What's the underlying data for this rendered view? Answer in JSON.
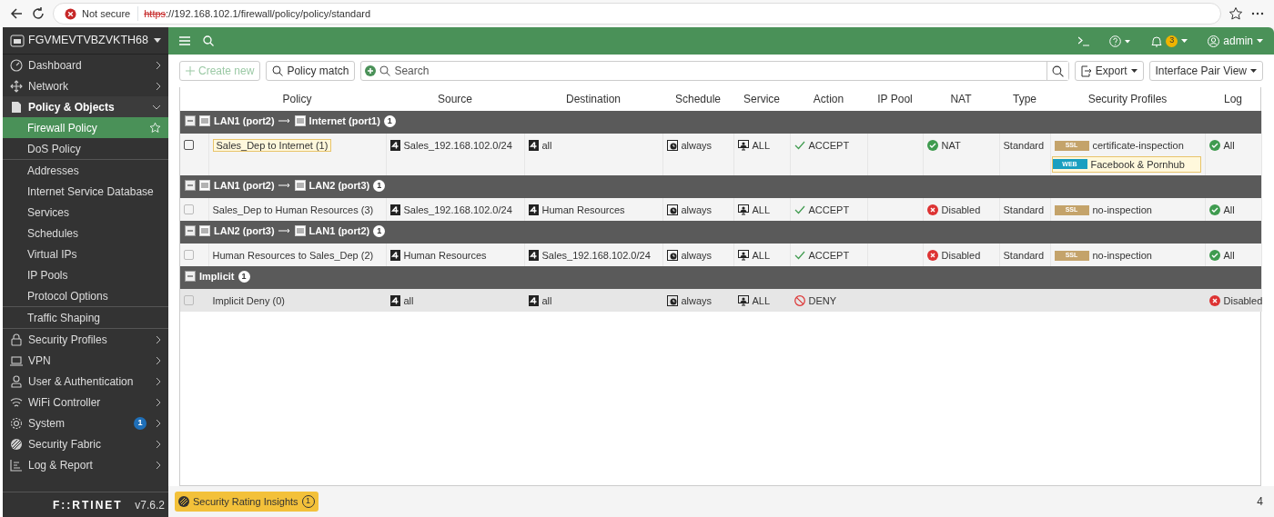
{
  "browser": {
    "security": "Not secure",
    "scheme": "https",
    "url": "://192.168.102.1/firewall/policy/policy/standard"
  },
  "sidebar": {
    "device": "FGVMEVTVBZVKTH68",
    "items": [
      {
        "label": "Dashboard",
        "expanded": false,
        "selected": false
      },
      {
        "label": "Network",
        "expanded": false,
        "selected": false
      },
      {
        "label": "Policy & Objects",
        "expanded": true,
        "selected": true,
        "children": [
          {
            "children": [
              {
                "label": "Firewall Policy",
                "selected": true
              },
              {
                "label": "DoS Policy",
                "selected": false
              }
            ]
          },
          {
            "children": [
              {
                "label": "Addresses",
                "selected": false
              },
              {
                "label": "Internet Service Database",
                "selected": false
              },
              {
                "label": "Services",
                "selected": false
              },
              {
                "label": "Schedules",
                "selected": false
              },
              {
                "label": "Virtual IPs",
                "selected": false
              },
              {
                "label": "IP Pools",
                "selected": false
              },
              {
                "label": "Protocol Options",
                "selected": false
              }
            ]
          },
          {
            "children": [
              {
                "label": "Traffic Shaping",
                "selected": false
              }
            ]
          }
        ]
      },
      {
        "label": "Security Profiles",
        "expanded": false,
        "selected": false
      },
      {
        "label": "VPN",
        "expanded": false,
        "selected": false
      },
      {
        "label": "User & Authentication",
        "expanded": false,
        "selected": false
      },
      {
        "label": "WiFi Controller",
        "expanded": false,
        "selected": false
      },
      {
        "label": "System",
        "expanded": false,
        "selected": false,
        "badge": "1"
      },
      {
        "label": "Security Fabric",
        "expanded": false,
        "selected": false
      },
      {
        "label": "Log & Report",
        "expanded": false,
        "selected": false
      }
    ],
    "logo": "F::RTINET",
    "version": "v7.6.2"
  },
  "header": {
    "notifications": "3",
    "user": "admin"
  },
  "toolbar": {
    "create": {
      "label": "Create new",
      "disabled": true
    },
    "match": "Policy match",
    "search": {
      "placeholder": "Search"
    },
    "export": "Export",
    "view": "Interface Pair View"
  },
  "table": {
    "columns": [
      "Policy",
      "Source",
      "Destination",
      "Schedule",
      "Service",
      "Action",
      "IP Pool",
      "NAT",
      "Type",
      "Security Profiles",
      "Log"
    ],
    "groups": [
      {
        "kind": "pair",
        "from": "LAN1 (port2)",
        "to": "Internet (port1)",
        "count": "1",
        "expanded": true,
        "rows": [
          {
            "name": "Sales_Dep to Internet (1)",
            "highlighted": true,
            "disabled": false,
            "implicit": false,
            "source": "Sales_192.168.102.0/24",
            "destination": "all",
            "schedule": "always",
            "service": "ALL",
            "action": {
              "kind": "accept",
              "label": "ACCEPT"
            },
            "nat": {
              "on": true,
              "label": "NAT"
            },
            "type": "Standard",
            "profiles": [
              {
                "kind": "ssl",
                "tag": "SSL",
                "name": "certificate-inspection",
                "highlighted": false
              },
              {
                "kind": "web",
                "tag": "WEB",
                "name": "Facebook & Pornhub",
                "highlighted": true
              }
            ],
            "log": {
              "on": true,
              "label": "All"
            }
          }
        ]
      },
      {
        "kind": "pair",
        "from": "LAN1 (port2)",
        "to": "LAN2 (port3)",
        "count": "1",
        "expanded": true,
        "rows": [
          {
            "name": "Sales_Dep to Human Resources (3)",
            "highlighted": false,
            "disabled": true,
            "implicit": false,
            "source": "Sales_192.168.102.0/24",
            "destination": "Human Resources",
            "schedule": "always",
            "service": "ALL",
            "action": {
              "kind": "accept",
              "label": "ACCEPT"
            },
            "nat": {
              "on": false,
              "label": "Disabled"
            },
            "type": "Standard",
            "profiles": [
              {
                "kind": "ssl",
                "tag": "SSL",
                "name": "no-inspection",
                "highlighted": false
              }
            ],
            "log": {
              "on": true,
              "label": "All"
            }
          }
        ]
      },
      {
        "kind": "pair",
        "from": "LAN2 (port3)",
        "to": "LAN1 (port2)",
        "count": "1",
        "expanded": true,
        "rows": [
          {
            "name": "Human Resources to Sales_Dep (2)",
            "highlighted": false,
            "disabled": true,
            "implicit": false,
            "source": "Human Resources",
            "destination": "Sales_192.168.102.0/24",
            "schedule": "always",
            "service": "ALL",
            "action": {
              "kind": "accept",
              "label": "ACCEPT"
            },
            "nat": {
              "on": false,
              "label": "Disabled"
            },
            "type": "Standard",
            "profiles": [
              {
                "kind": "ssl",
                "tag": "SSL",
                "name": "no-inspection",
                "highlighted": false
              }
            ],
            "log": {
              "on": true,
              "label": "All"
            }
          }
        ]
      },
      {
        "kind": "label",
        "label": "Implicit",
        "count": "1",
        "expanded": true,
        "rows": [
          {
            "name": "Implicit Deny (0)",
            "highlighted": false,
            "disabled": true,
            "implicit": true,
            "source": "all",
            "destination": "all",
            "schedule": "always",
            "service": "ALL",
            "action": {
              "kind": "deny",
              "label": "DENY"
            },
            "log": {
              "on": false,
              "label": "Disabled"
            }
          }
        ]
      }
    ]
  },
  "footer": {
    "insights": "Security Rating Insights",
    "insights_count": "1",
    "total": "4"
  }
}
